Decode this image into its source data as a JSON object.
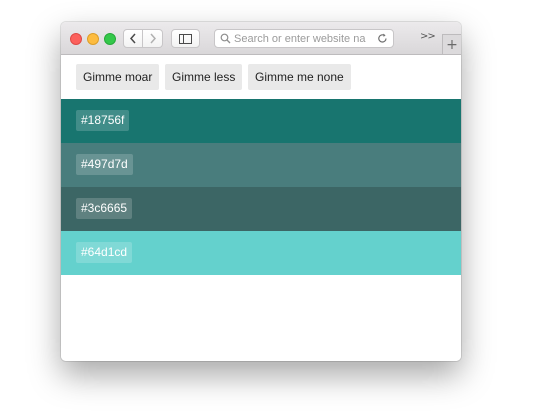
{
  "browser": {
    "address_placeholder": "Search or enter website name",
    "overflow_label": ">>",
    "new_tab_label": "+"
  },
  "toolbar": {
    "moar_label": "Gimme moar",
    "less_label": "Gimme less",
    "none_label": "Gimme me none"
  },
  "swatches": [
    {
      "label": "#18756f",
      "color": "#18756f"
    },
    {
      "label": "#497d7d",
      "color": "#497d7d"
    },
    {
      "label": "#3c6665",
      "color": "#3c6665"
    },
    {
      "label": "#64d1cd",
      "color": "#64d1cd"
    }
  ],
  "icons": {
    "back": "chevron-left-icon",
    "forward": "chevron-right-icon",
    "sidebar": "sidebar-icon",
    "search": "search-icon",
    "reload": "reload-icon"
  },
  "colors": {
    "close": "#fc605c",
    "minimize": "#fdbc40",
    "zoom": "#34c84a",
    "button_bg": "#e9e9e9"
  }
}
